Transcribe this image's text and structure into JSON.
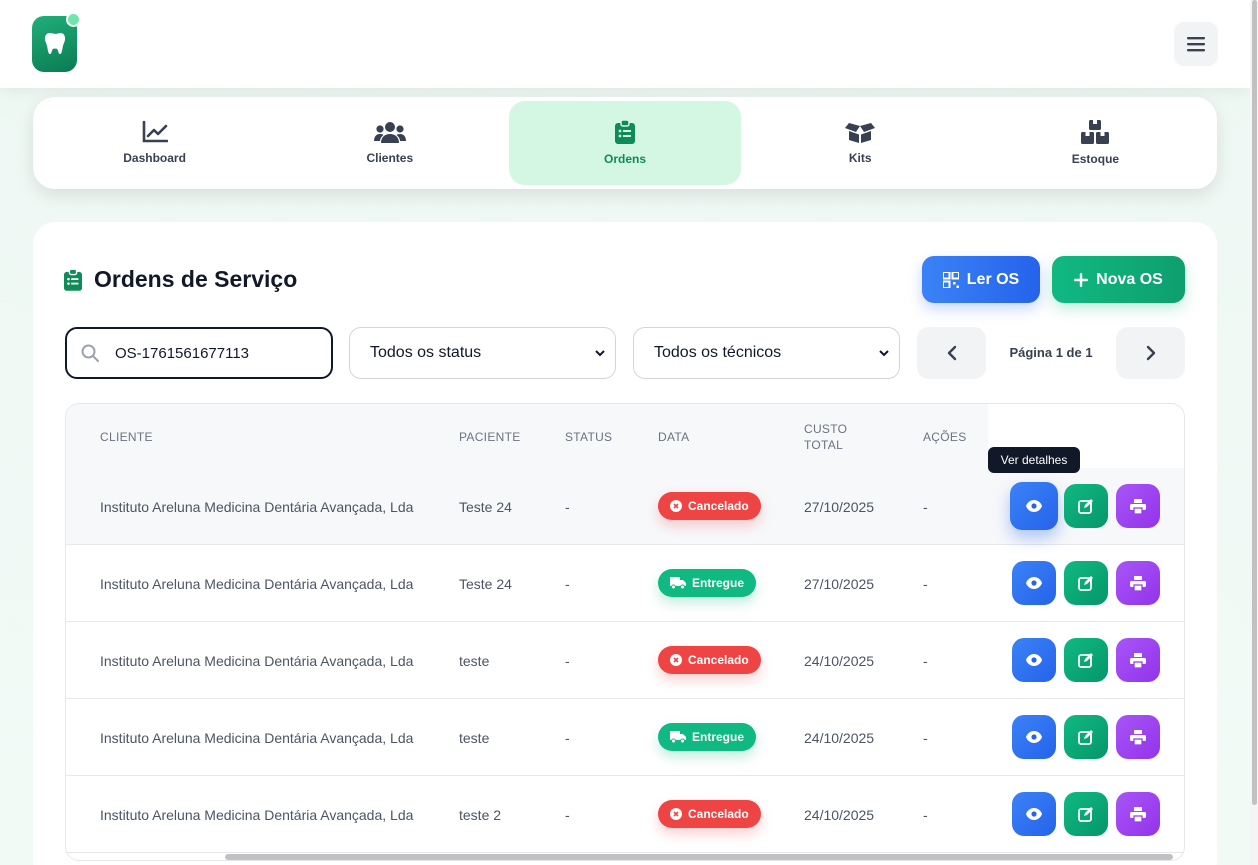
{
  "app": {
    "logo_icon": "tooth-icon",
    "menu_icon": "hamburger-icon"
  },
  "nav": {
    "items": [
      {
        "label": "Dashboard",
        "icon": "chart-line-icon",
        "active": false
      },
      {
        "label": "Clientes",
        "icon": "users-icon",
        "active": false
      },
      {
        "label": "Ordens",
        "icon": "clipboard-list-icon",
        "active": true
      },
      {
        "label": "Kits",
        "icon": "box-open-icon",
        "active": false
      },
      {
        "label": "Estoque",
        "icon": "boxes-icon",
        "active": false
      }
    ]
  },
  "page": {
    "title": "Ordens de Serviço",
    "ler_os_label": "Ler OS",
    "nova_os_label": "Nova OS"
  },
  "filters": {
    "search_value": "OS-1761561677113",
    "status_select": "Todos os status",
    "tecnico_select": "Todos os técnicos",
    "pagination_text": "Página 1 de 1"
  },
  "table": {
    "headers": {
      "cliente": "CLIENTE",
      "paciente": "PACIENTE",
      "status": "STATUS",
      "data": "DATA",
      "custo_1": "CUSTO",
      "custo_2": "TOTAL",
      "acoes": "AÇÕES"
    },
    "rows": [
      {
        "cliente": "Instituto Areluna Medicina Dentária Avançada, Lda",
        "paciente": "Teste 24",
        "status_col": "-",
        "badge": "Cancelado",
        "data": "27/10/2025",
        "custo": "-"
      },
      {
        "cliente": "Instituto Areluna Medicina Dentária Avançada, Lda",
        "paciente": "Teste 24",
        "status_col": "-",
        "badge": "Entregue",
        "data": "27/10/2025",
        "custo": "-"
      },
      {
        "cliente": "Instituto Areluna Medicina Dentária Avançada, Lda",
        "paciente": "teste",
        "status_col": "-",
        "badge": "Cancelado",
        "data": "24/10/2025",
        "custo": "-"
      },
      {
        "cliente": "Instituto Areluna Medicina Dentária Avançada, Lda",
        "paciente": "teste",
        "status_col": "-",
        "badge": "Entregue",
        "data": "24/10/2025",
        "custo": "-"
      },
      {
        "cliente": "Instituto Areluna Medicina Dentária Avançada, Lda",
        "paciente": "teste 2",
        "status_col": "-",
        "badge": "Cancelado",
        "data": "24/10/2025",
        "custo": "-"
      }
    ],
    "tooltip": "Ver detalhes"
  },
  "colors": {
    "primary_green": "#10b981",
    "primary_blue": "#2563eb",
    "purple": "#9333ea",
    "danger": "#ef4444",
    "active_nav_bg": "#d4f7e3"
  }
}
